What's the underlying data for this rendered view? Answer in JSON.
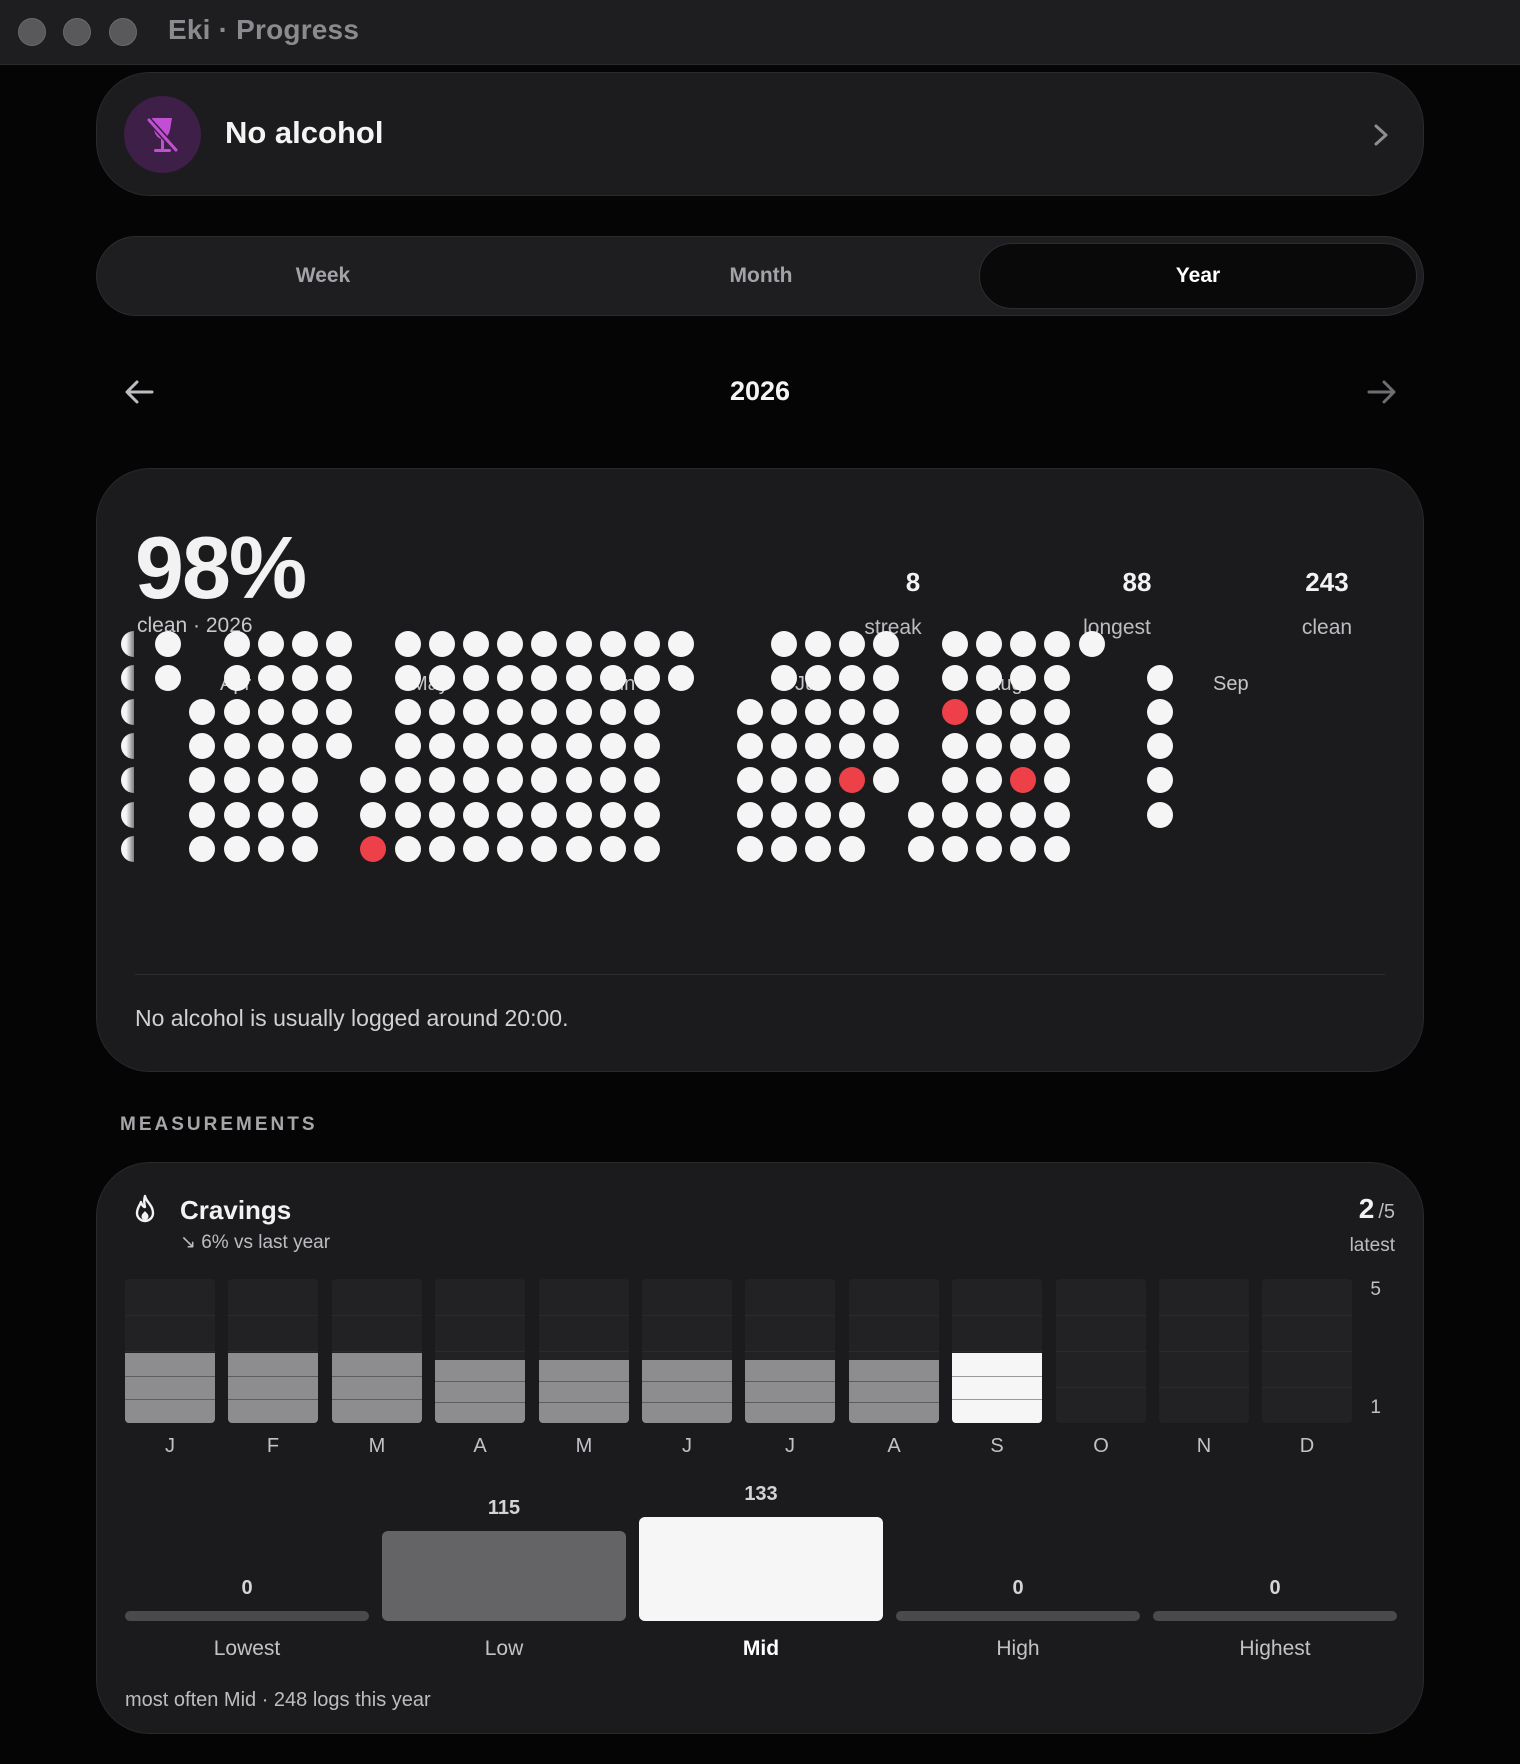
{
  "window": {
    "title": "Eki · Progress"
  },
  "habit": {
    "name": "No alcohol",
    "icon": "no-wine-glass-icon",
    "icon_color": "#c24fd3"
  },
  "tabs": [
    {
      "label": "Week",
      "active": false
    },
    {
      "label": "Month",
      "active": false
    },
    {
      "label": "Year",
      "active": true
    }
  ],
  "period": {
    "label": "2026"
  },
  "summary": {
    "percent": "98%",
    "subtitle": "clean · 2026",
    "stats": [
      {
        "value": "8",
        "label": "streak"
      },
      {
        "value": "88",
        "label": "longest"
      },
      {
        "value": "243",
        "label": "clean"
      }
    ],
    "months": [
      "Apr",
      "May",
      "Jun",
      "Jul",
      "Aug",
      "Sep"
    ],
    "insight": "No alcohol is usually logged around 20:00.",
    "colors": {
      "clean": "#f5f5f5",
      "missed": "#ee4048"
    }
  },
  "measurements": {
    "header": "MEASUREMENTS",
    "cravings": {
      "title": "Cravings",
      "icon": "flame-icon",
      "trend": "↘ 6% vs last year",
      "latest_value": "2",
      "latest_denominator": "/5",
      "latest_label": "latest",
      "chart_data": {
        "type": "bar",
        "categories": [
          "J",
          "F",
          "M",
          "A",
          "M",
          "J",
          "J",
          "A",
          "S",
          "O",
          "N",
          "D"
        ],
        "values": [
          2.1,
          2.1,
          2.1,
          2.0,
          2.0,
          2.0,
          2.0,
          2.0,
          2.1,
          null,
          null,
          null
        ],
        "current_index": 8,
        "ylim": [
          1,
          5
        ],
        "y_ticks": [
          "5",
          "1"
        ]
      },
      "distribution": {
        "type": "bar",
        "categories": [
          "Lowest",
          "Low",
          "Mid",
          "High",
          "Highest"
        ],
        "values": [
          0,
          115,
          133,
          0,
          0
        ],
        "max_index": 2
      },
      "footer": "most often Mid · 248 logs this year"
    }
  }
}
